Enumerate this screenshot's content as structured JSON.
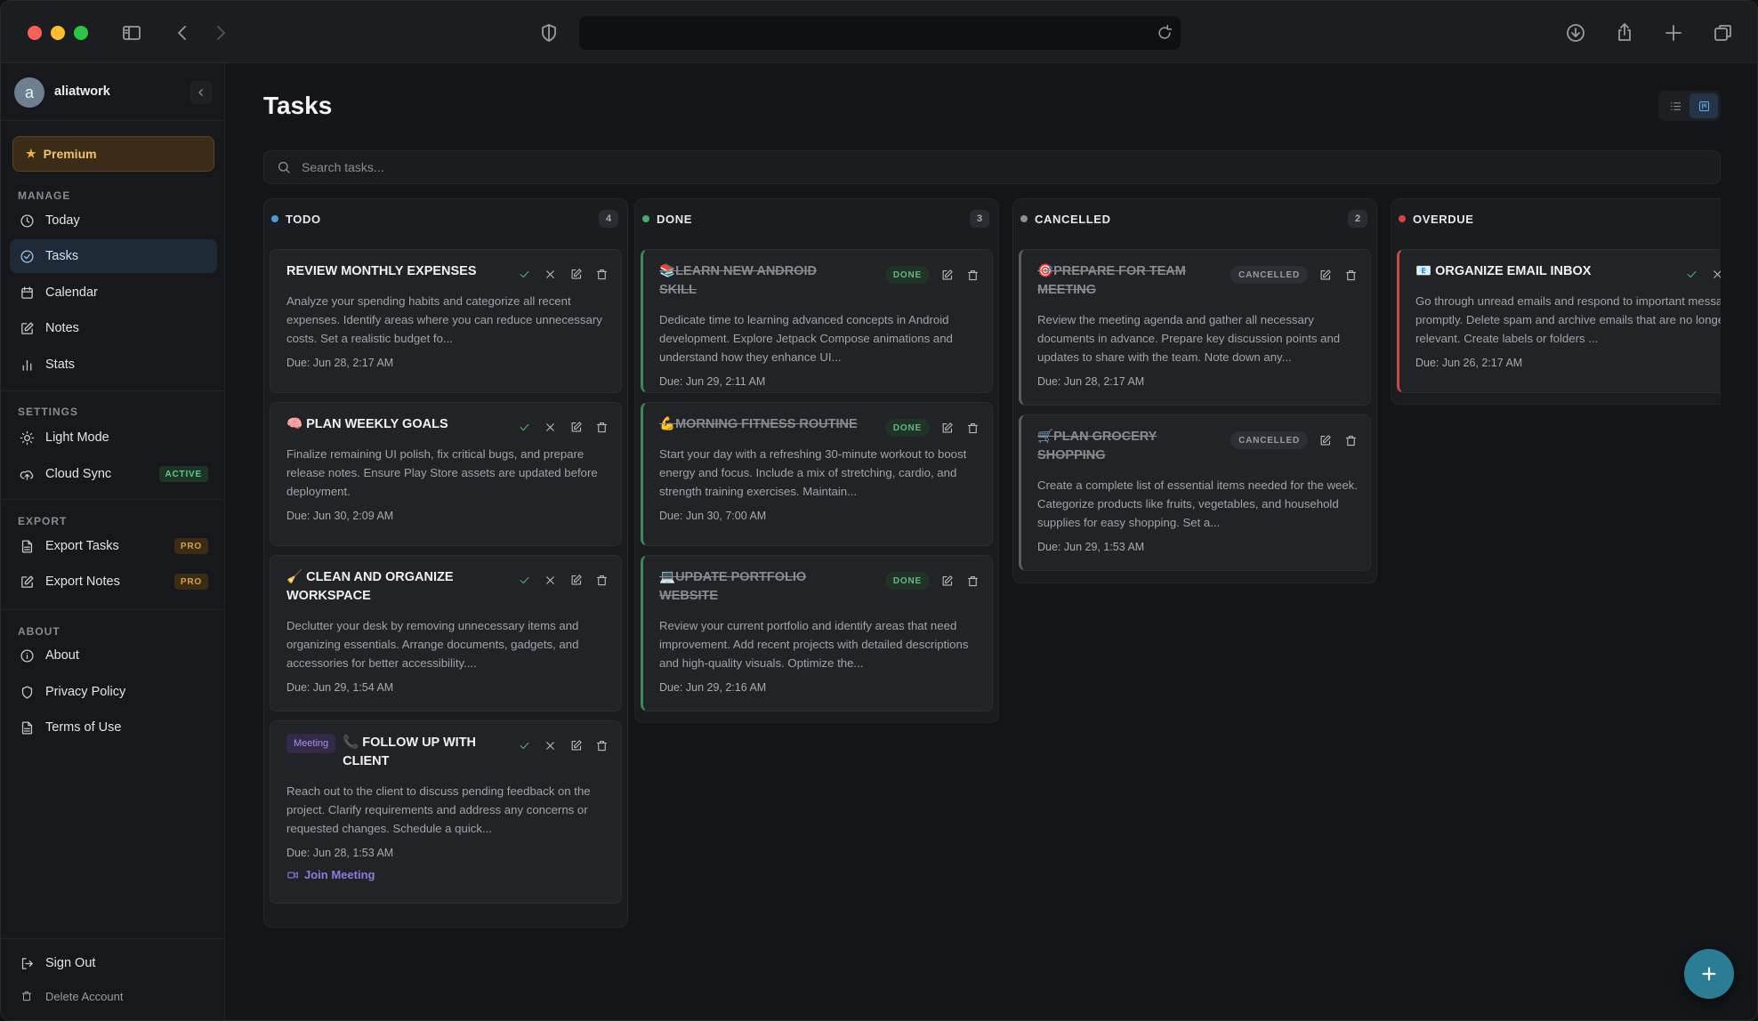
{
  "user": {
    "initial": "a",
    "name": "aliatwork"
  },
  "premium_label": "Premium",
  "sidebar": {
    "manage_heading": "MANAGE",
    "manage": [
      "Today",
      "Tasks",
      "Calendar",
      "Notes",
      "Stats"
    ],
    "settings_heading": "SETTINGS",
    "settings": [
      "Light Mode",
      "Cloud Sync"
    ],
    "cloud_sync_badge": "ACTIVE",
    "export_heading": "EXPORT",
    "export": [
      "Export Tasks",
      "Export Notes"
    ],
    "pro_badge": "PRO",
    "about_heading": "ABOUT",
    "about": [
      "About",
      "Privacy Policy",
      "Terms of Use"
    ],
    "sign_out": "Sign Out",
    "delete_account": "Delete Account"
  },
  "main": {
    "title": "Tasks",
    "search_placeholder": "Search tasks..."
  },
  "columns": [
    {
      "name": "TODO",
      "count": "4",
      "color": "#4a9fd8"
    },
    {
      "name": "DONE",
      "count": "3",
      "color": "#3fae6a"
    },
    {
      "name": "CANCELLED",
      "count": "2",
      "color": "#8e8f95"
    },
    {
      "name": "OVERDUE",
      "count": "",
      "color": "#d64545"
    }
  ],
  "todo": [
    {
      "emoji": "",
      "title": "REVIEW MONTHLY EXPENSES",
      "desc": "Analyze your spending habits and categorize all recent expenses. Identify areas where you can reduce unnecessary costs. Set a realistic budget fo...",
      "due": "Due: Jun 28, 2:17 AM"
    },
    {
      "emoji": "🧠",
      "title": "PLAN WEEKLY GOALS",
      "desc": "Finalize remaining UI polish, fix critical bugs, and prepare release notes. Ensure Play Store assets are updated before deployment.",
      "due": "Due: Jun 30, 2:09 AM"
    },
    {
      "emoji": "🧹",
      "title": "CLEAN AND ORGANIZE WORKSPACE",
      "desc": "Declutter your desk by removing unnecessary items and organizing essentials. Arrange documents, gadgets, and accessories for better accessibility....",
      "due": "Due: Jun 29, 1:54 AM"
    },
    {
      "tag": "Meeting",
      "emoji": "📞",
      "title": "FOLLOW UP WITH CLIENT",
      "desc": "Reach out to the client to discuss pending feedback on the project. Clarify requirements and address any concerns or requested changes. Schedule a quick...",
      "due": "Due: Jun 28, 1:53 AM",
      "link": "Join Meeting"
    }
  ],
  "done": [
    {
      "emoji": "📚",
      "title": "LEARN NEW ANDROID SKILL",
      "badge": "DONE",
      "desc": "Dedicate time to learning advanced concepts in Android development. Explore Jetpack Compose animations and understand how they enhance UI...",
      "due": "Due: Jun 29, 2:11 AM"
    },
    {
      "emoji": "💪",
      "title": "MORNING FITNESS ROUTINE",
      "badge": "DONE",
      "desc": "Start your day with a refreshing 30-minute workout to boost energy and focus. Include a mix of stretching, cardio, and strength training exercises. Maintain...",
      "due": "Due: Jun 30, 7:00 AM"
    },
    {
      "emoji": "💻",
      "title": "UPDATE PORTFOLIO WEBSITE",
      "badge": "DONE",
      "desc": "Review your current portfolio and identify areas that need improvement. Add recent projects with detailed descriptions and high-quality visuals. Optimize the...",
      "due": "Due: Jun 29, 2:16 AM"
    }
  ],
  "cancelled": [
    {
      "emoji": "🎯",
      "title": "PREPARE FOR TEAM MEETING",
      "badge": "CANCELLED",
      "desc": "Review the meeting agenda and gather all necessary documents in advance. Prepare key discussion points and updates to share with the team. Note down any...",
      "due": "Due: Jun 28, 2:17 AM"
    },
    {
      "emoji": "🛒",
      "title": "PLAN GROCERY SHOPPING",
      "badge": "CANCELLED",
      "desc": "Create a complete list of essential items needed for the week. Categorize products like fruits, vegetables, and household supplies for easy shopping. Set a...",
      "due": "Due: Jun 29, 1:53 AM"
    }
  ],
  "overdue": [
    {
      "emoji": "📧",
      "title": "ORGANIZE EMAIL INBOX",
      "desc": "Go through unread emails and respond to important messages promptly. Delete spam and archive emails that are no longer relevant. Create labels or folders ...",
      "due": "Due: Jun 26, 2:17 AM"
    }
  ]
}
